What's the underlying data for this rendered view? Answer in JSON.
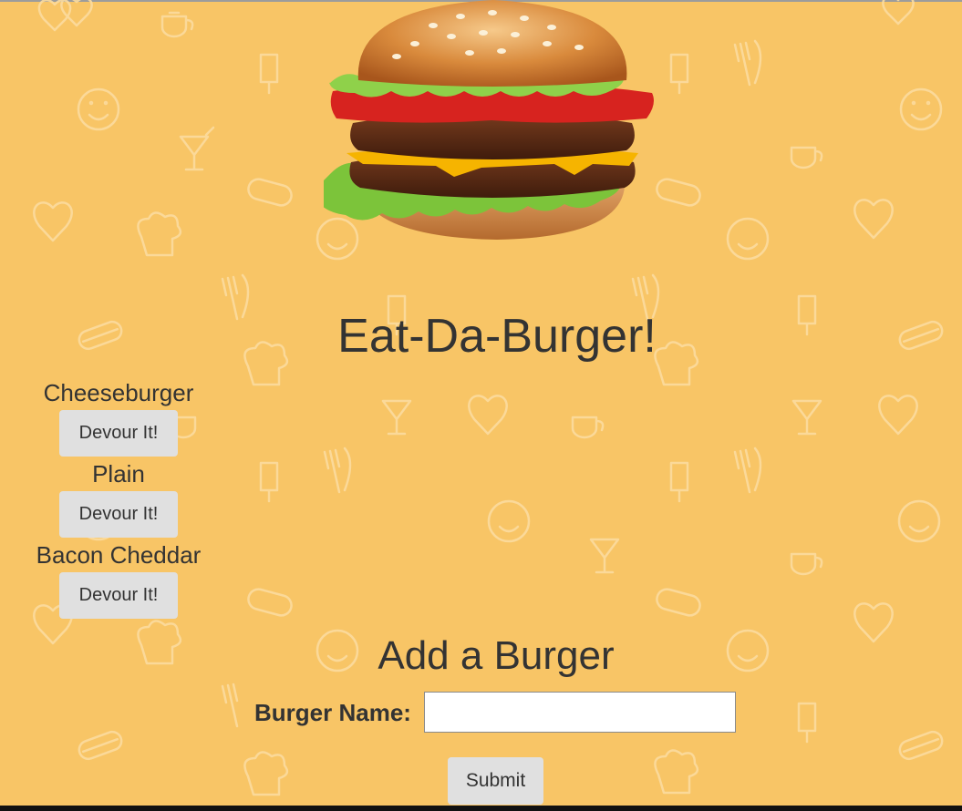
{
  "page": {
    "title": "Eat-Da-Burger!",
    "hero_image": "burger-image",
    "background_color": "#f8c566",
    "pattern_icons": [
      "heart-icon",
      "teapot-icon",
      "smiley-icon",
      "cocktail-icon",
      "chef-hat-icon",
      "hotdog-icon",
      "fork-knife-icon",
      "popsicle-icon"
    ]
  },
  "burgers": [
    {
      "name": "Cheeseburger",
      "action": "Devour It!"
    },
    {
      "name": "Plain",
      "action": "Devour It!"
    },
    {
      "name": "Bacon Cheddar",
      "action": "Devour It!"
    }
  ],
  "form": {
    "heading": "Add a Burger",
    "label": "Burger Name:",
    "value": "",
    "submit_label": "Submit"
  }
}
